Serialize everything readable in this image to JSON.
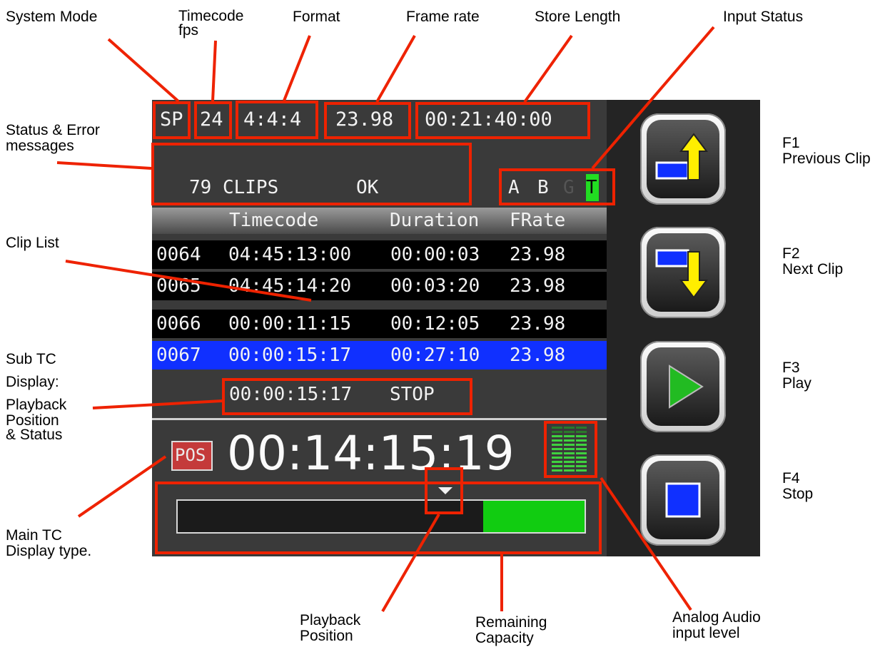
{
  "annotations": {
    "system_mode": "System Mode",
    "timecode_fps_1": "Timecode",
    "timecode_fps_2": "fps",
    "format": "Format",
    "frame_rate": "Frame rate",
    "store_length": "Store Length",
    "input_status": "Input Status",
    "status_error_1": "Status & Error",
    "status_error_2": "messages",
    "clip_list": "Clip List",
    "sub_tc_1": "Sub TC",
    "sub_tc_2": "Display:",
    "sub_tc_3": "Playback",
    "sub_tc_4": "Position",
    "sub_tc_5": "& Status",
    "main_tc_1": "Main TC",
    "main_tc_2": "Display type.",
    "playback_pos_1": "Playback",
    "playback_pos_2": "Position",
    "remaining_1": "Remaining",
    "remaining_2": "Capacity",
    "analog_1": "Analog Audio",
    "analog_2": "input level",
    "f1_key": "F1",
    "f1_name": "Previous Clip",
    "f2_key": "F2",
    "f2_name": "Next Clip",
    "f3_key": "F3",
    "f3_name": "Play",
    "f4_key": "F4",
    "f4_name": "Stop"
  },
  "status_bar": {
    "system_mode": "SP",
    "timecode_fps": "24",
    "format": "4:4:4",
    "frame_rate": "23.98",
    "store_length": "00:21:40:00"
  },
  "messages": {
    "clips": "79 CLIPS",
    "status": "OK"
  },
  "inputs": {
    "a": "A",
    "b": "B",
    "g": "G",
    "t": "T"
  },
  "clip_list": {
    "headers": [
      "Timecode",
      "Duration",
      "FRate"
    ],
    "rows": [
      {
        "id": "0064",
        "timecode": "04:45:13:00",
        "duration": "00:00:03",
        "frate": "23.98"
      },
      {
        "id": "0065",
        "timecode": "04:45:14:20",
        "duration": "00:03:20",
        "frate": "23.98"
      },
      {
        "id": "0066",
        "timecode": "00:00:11:15",
        "duration": "00:12:05",
        "frate": "23.98"
      },
      {
        "id": "0067",
        "timecode": "00:00:15:17",
        "duration": "00:27:10",
        "frate": "23.98"
      }
    ],
    "selected_index": 3
  },
  "sub_tc": {
    "timecode": "00:00:15:17",
    "status": "STOP"
  },
  "main_tc": {
    "type": "POS",
    "timecode": "00:14:15:19"
  },
  "capacity": {
    "remaining_fraction": 0.25
  },
  "colors": {
    "annotation_red": "#ee2200",
    "selected_row": "#1030ff",
    "input_active": "#22dd22",
    "capacity_bar": "#11cc11",
    "button_arrow_yellow": "#ffee00",
    "button_blue": "#1030ff",
    "play_green": "#22bb22"
  },
  "buttons": {
    "f1_icon": "previous-clip-icon",
    "f2_icon": "next-clip-icon",
    "f3_icon": "play-icon",
    "f4_icon": "stop-icon"
  }
}
